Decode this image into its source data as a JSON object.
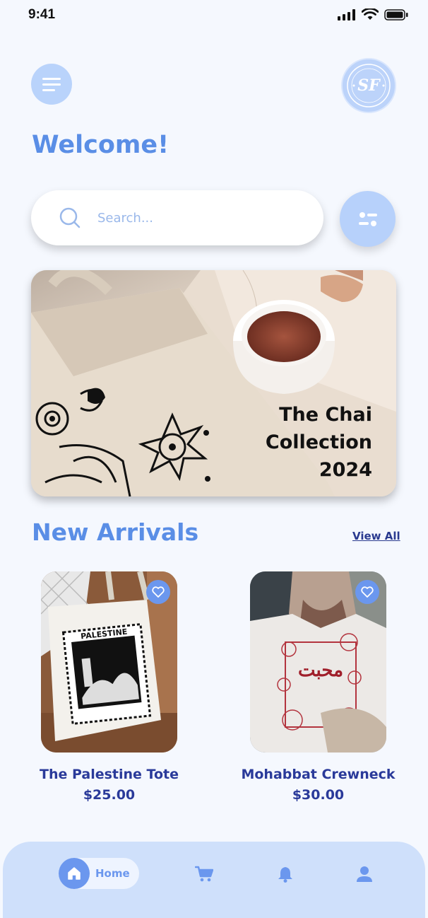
{
  "status_bar": {
    "time": "9:41"
  },
  "header": {
    "logo_text": "SF",
    "welcome": "Welcome!"
  },
  "search": {
    "placeholder": "Search..."
  },
  "banner": {
    "title": "The Chai\nCollection\n2024"
  },
  "new_arrivals": {
    "title": "New Arrivals",
    "view_all": "View All",
    "products": [
      {
        "name": "The Palestine Tote",
        "price": "$25.00"
      },
      {
        "name": "Mohabbat Crewneck",
        "price": "$30.00"
      }
    ]
  },
  "tabbar": {
    "items": [
      {
        "label": "Home",
        "icon": "home-icon",
        "active": true
      },
      {
        "icon": "cart-icon"
      },
      {
        "icon": "bell-icon"
      },
      {
        "icon": "profile-icon"
      }
    ]
  },
  "colors": {
    "accent": "#5a8ee6",
    "accent_strong": "#6b97ee",
    "light_blue": "#b9d3fb",
    "navy_text": "#2a3a9a",
    "background": "#f5f8fe"
  }
}
